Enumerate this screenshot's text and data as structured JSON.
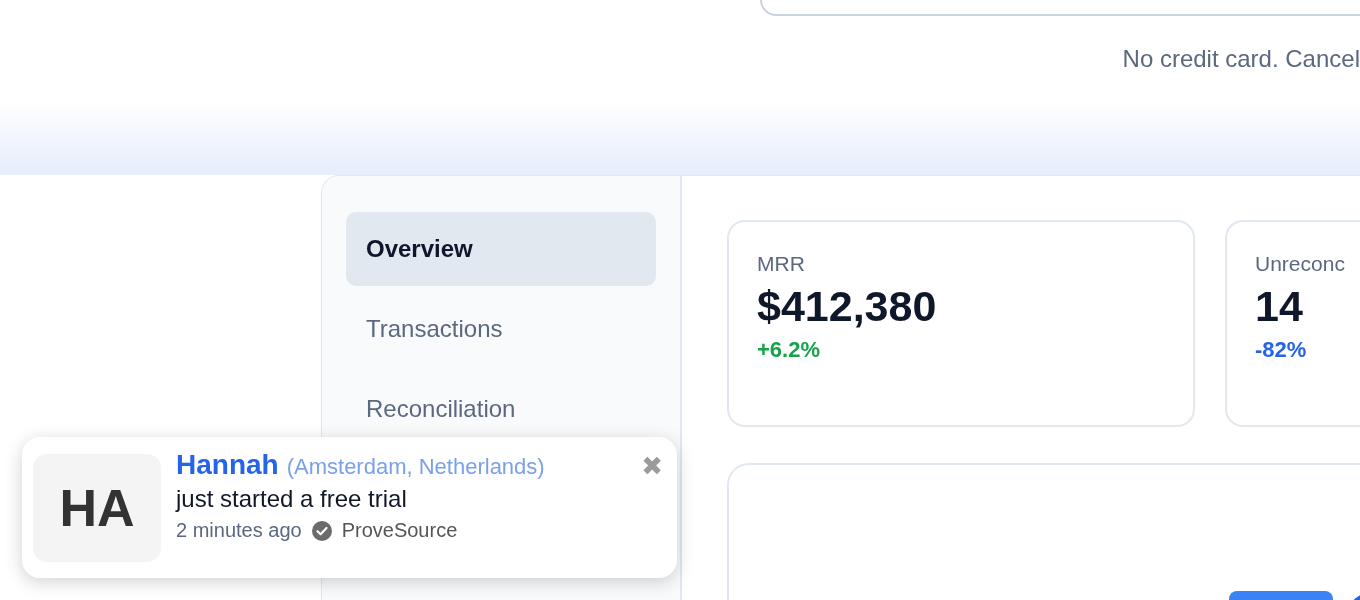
{
  "hero": {
    "note": "No credit card. Cancel"
  },
  "sidebar": {
    "items": [
      {
        "label": "Overview",
        "selected": true
      },
      {
        "label": "Transactions",
        "selected": false
      },
      {
        "label": "Reconciliation",
        "selected": false
      }
    ]
  },
  "metrics": [
    {
      "label": "MRR",
      "value": "$412,380",
      "change": "+6.2%",
      "color": "#16a34a"
    },
    {
      "label": "Unreconc",
      "value": "14",
      "change": "-82%",
      "color": "#2563eb"
    }
  ],
  "notification": {
    "initials": "HA",
    "name": "Hannah",
    "location": "(Amsterdam, Netherlands)",
    "message": "just started a free trial",
    "time": "2 minutes ago",
    "source": "ProveSource",
    "close": "✖"
  }
}
